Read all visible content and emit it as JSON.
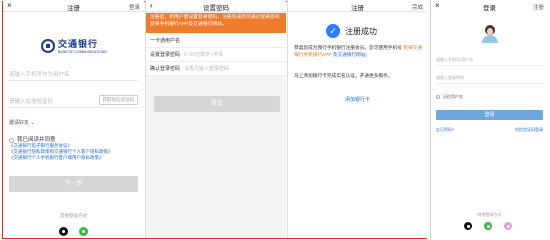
{
  "screen1": {
    "close": "×",
    "title": "注册",
    "right": "登录",
    "logo_cn": "交通银行",
    "logo_en": "BANK OF COMMUNICATIONS",
    "phone_placeholder": "请输入手机号作为用户名",
    "code_placeholder": "请输入短信验证码",
    "code_button": "获取短信验证码",
    "invite": "邀请好友",
    "invite_arrow": "⌄",
    "agree_title": "我已阅读并同意",
    "agreements": [
      "《交通银行电子银行服务协议》",
      "《交通银行隐私政策和交通银行个人客户隐私政策》",
      "《交通银行个人手机银行客户端用户隐私政策》"
    ],
    "next_button": "下一步",
    "other_login": "其他登录方式"
  },
  "screen2": {
    "back": "‹",
    "title": "设置密码",
    "banner": "注册后，新用户需设置登录密码，注册完成后可通过登录密码登录手机银行APP及交通银行网站。",
    "rows": [
      {
        "label": "一卡通用户名",
        "placeholder": ""
      },
      {
        "label": "设置登录密码",
        "placeholder": "6~20位数字+字母"
      },
      {
        "label": "确认登录密码",
        "placeholder": "请再次输入登录密码"
      }
    ],
    "submit": "提交"
  },
  "screen3": {
    "title": "注册",
    "right": "完成",
    "success": "注册成功",
    "p1a": "恭喜您成为我行手机银行注册会员。您可使用手机号",
    "p1b": "登录交通银行手机银行APP",
    "p1c": "及交通银行网站。",
    "p2": "马上添加银行卡完成实名认证，开通更多服务。",
    "add_card": "添加银行卡"
  },
  "screen4": {
    "close": "×",
    "title": "登录",
    "right": "注册",
    "phone_placeholder": "请输入手机号/用户名",
    "pwd_placeholder": "请输入登录密码",
    "remember": "记住用户名",
    "login_button": "登录",
    "forgot": "忘记密码?",
    "sms_login": "短信验证码登录",
    "other_login": "其他登录方式"
  }
}
